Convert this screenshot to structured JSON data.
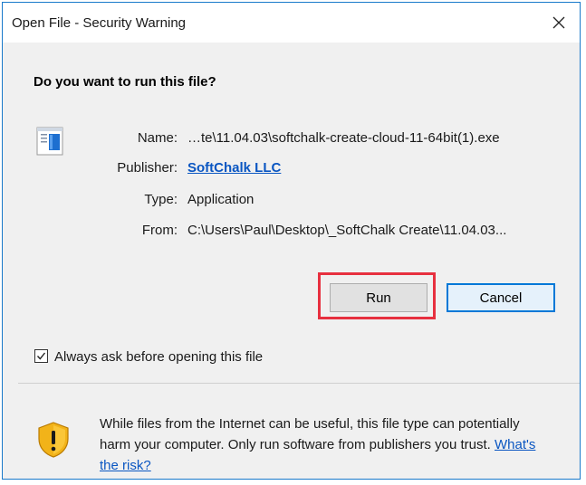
{
  "window": {
    "title": "Open File - Security Warning",
    "close_glyph": "✕"
  },
  "dialog": {
    "question": "Do you want to run this file?",
    "file_icon": "executable-file-icon",
    "fields": {
      "name_label": "Name:",
      "name_value": "…te\\11.04.03\\softchalk-create-cloud-11-64bit(1).exe",
      "publisher_label": "Publisher:",
      "publisher_value": "SoftChalk LLC",
      "type_label": "Type:",
      "type_value": "Application",
      "from_label": "From:",
      "from_value": "C:\\Users\\Paul\\Desktop\\_SoftChalk Create\\11.04.03..."
    },
    "buttons": {
      "run": "Run",
      "cancel": "Cancel"
    },
    "always_ask": {
      "label": "Always ask before opening this file",
      "checked": true
    },
    "warning": {
      "icon": "security-shield-icon",
      "text": "While files from the Internet can be useful, this file type can potentially harm your computer. Only run software from publishers you trust. ",
      "link": "What's the risk?"
    }
  },
  "colors": {
    "window_border": "#1979ca",
    "dialog_bg": "#f0f0f0",
    "link": "#0a56c2",
    "highlight": "#e7303f",
    "default_button_border": "#0078d7"
  }
}
